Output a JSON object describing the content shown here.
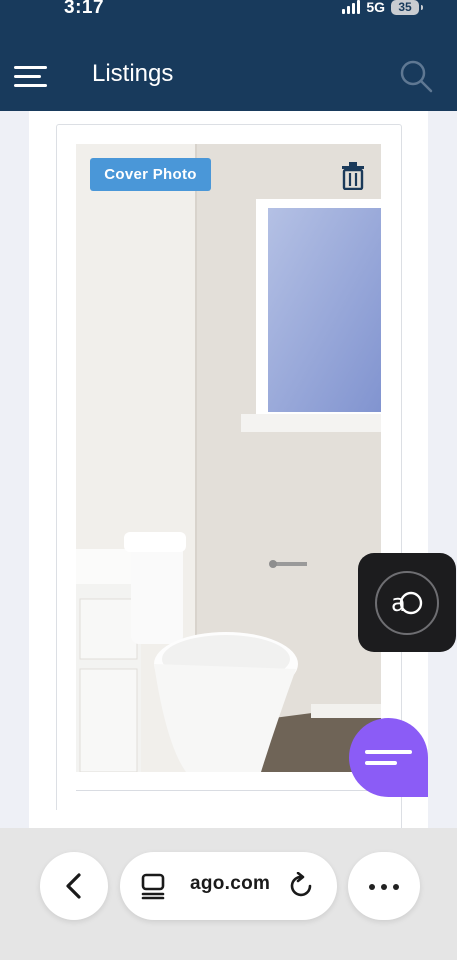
{
  "status_bar": {
    "time": "3:17",
    "network": "5G",
    "battery": "35"
  },
  "header": {
    "title": "Listings"
  },
  "photo": {
    "badge": "Cover Photo"
  },
  "browser": {
    "url": "ago.com"
  },
  "colors": {
    "header_bg": "#183a5c",
    "badge_bg": "#4a97d8",
    "chat_button": "#8b5cf6",
    "page_bg": "#eef0f6"
  },
  "icons": [
    "menu-icon",
    "search-icon",
    "trash-icon",
    "assistant-icon",
    "chat-icon",
    "back-icon",
    "reader-icon",
    "reload-icon",
    "more-icon"
  ]
}
